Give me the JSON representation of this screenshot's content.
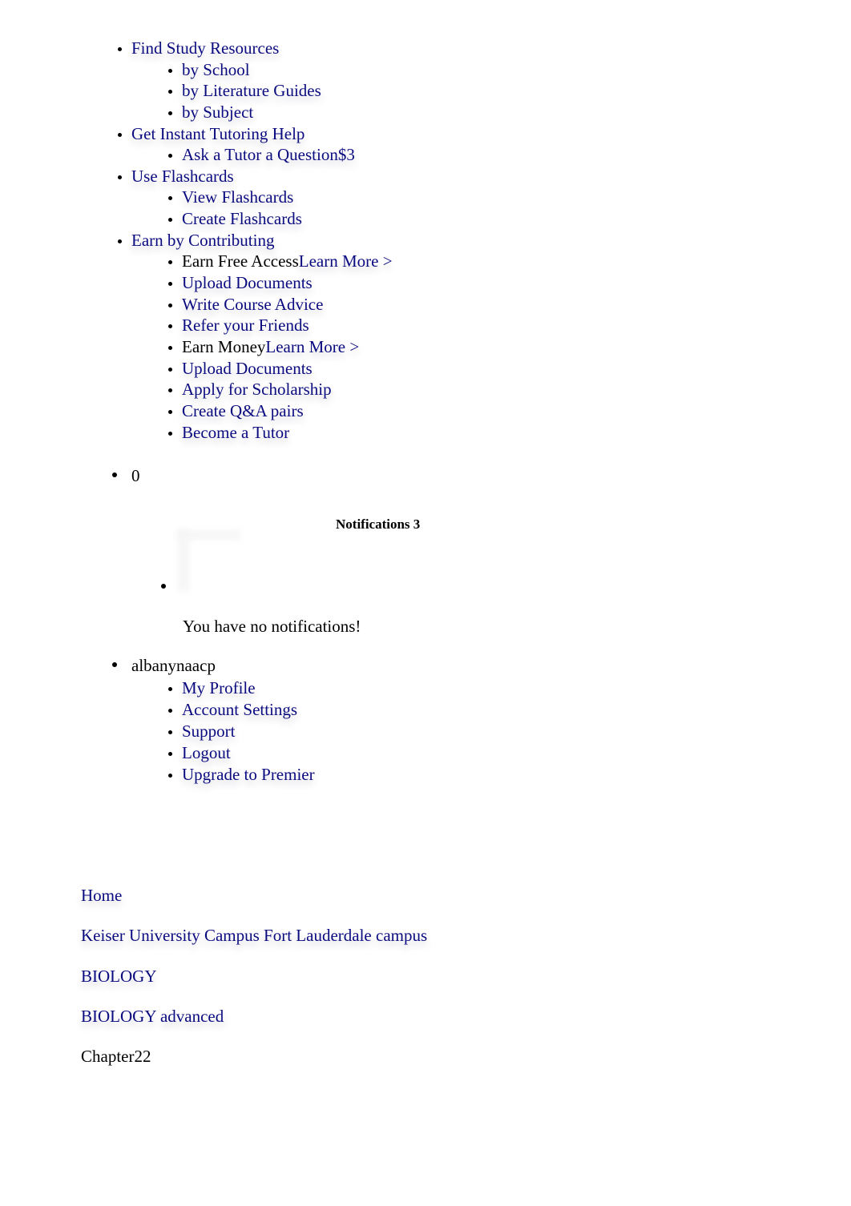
{
  "nav": {
    "items": [
      {
        "label": "Find Study Resources",
        "children": [
          {
            "label": "by School"
          },
          {
            "label": "by Literature Guides"
          },
          {
            "label": "by Subject"
          }
        ]
      },
      {
        "label": "Get Instant Tutoring Help",
        "children": [
          {
            "label": "Ask a Tutor a Question$3"
          }
        ]
      },
      {
        "label": "Use Flashcards",
        "children": [
          {
            "label": "View Flashcards"
          },
          {
            "label": "Create Flashcards"
          }
        ]
      },
      {
        "label": "Earn by Contributing",
        "children": [
          {
            "prefix": "Earn Free Access",
            "label": "Learn More >"
          },
          {
            "label": "Upload Documents"
          },
          {
            "label": "Write Course Advice"
          },
          {
            "label": "Refer your Friends"
          },
          {
            "prefix": "Earn Money",
            "label": "Learn More >"
          },
          {
            "label": "Upload Documents"
          },
          {
            "label": "Apply for Scholarship"
          },
          {
            "label": "Create Q&A pairs"
          },
          {
            "label": "Become a Tutor"
          }
        ]
      }
    ]
  },
  "notifications": {
    "count_label": "0",
    "title": "Notifications 3",
    "empty_message": "You have no notifications!"
  },
  "user": {
    "username": "albanynaacp",
    "menu": [
      {
        "label": "My Profile"
      },
      {
        "label": "Account Settings"
      },
      {
        "label": "Support"
      },
      {
        "label": "Logout"
      },
      {
        "label": "Upgrade to Premier"
      }
    ]
  },
  "breadcrumb": [
    {
      "label": "Home"
    },
    {
      "label": "Keiser University Campus Fort Lauderdale campus"
    },
    {
      "label": "BIOLOGY"
    },
    {
      "label": "BIOLOGY advanced"
    },
    {
      "label": "Chapter22"
    }
  ]
}
